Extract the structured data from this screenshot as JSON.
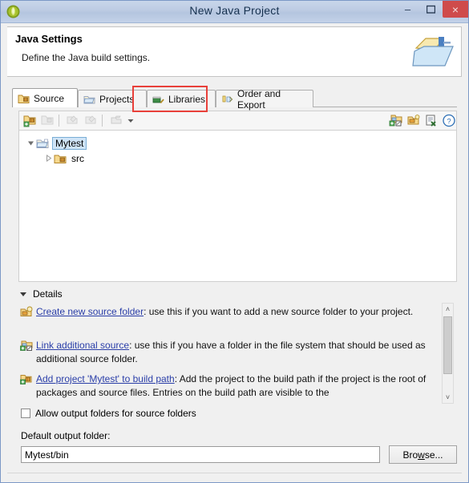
{
  "window": {
    "title": "New Java Project",
    "app_icon": "eclipse-icon",
    "controls": {
      "minimize": "–",
      "maximize": "❐",
      "close": "×"
    }
  },
  "header": {
    "title": "Java Settings",
    "subtitle": "Define the Java build settings.",
    "banner_icon": "java-project-wizard-icon"
  },
  "tabs": [
    {
      "label": "Source",
      "icon": "source-folder-icon",
      "active": true,
      "highlighted": false
    },
    {
      "label": "Projects",
      "icon": "projects-icon",
      "active": false,
      "highlighted": false
    },
    {
      "label": "Libraries",
      "icon": "libraries-icon",
      "active": false,
      "highlighted": true
    },
    {
      "label": "Order and Export",
      "icon": "order-export-icon",
      "active": false,
      "highlighted": false
    }
  ],
  "highlight": {
    "color": "#e8403a",
    "target": "Libraries"
  },
  "toolbar": {
    "left_items": [
      {
        "name": "add-folder-icon",
        "enabled": true
      },
      {
        "name": "add-source-folder-icon",
        "enabled": false
      },
      {
        "name": "edit-filter-icon",
        "enabled": false
      },
      {
        "name": "edit-exclusion-icon",
        "enabled": false
      },
      {
        "name": "configure-icon",
        "enabled": false
      },
      {
        "name": "chevron-down-icon",
        "enabled": true
      }
    ],
    "right_items": [
      {
        "name": "link-source-icon",
        "enabled": true
      },
      {
        "name": "create-new-folder-icon",
        "enabled": true
      },
      {
        "name": "remove-entry-icon",
        "enabled": true
      },
      {
        "name": "help-icon",
        "enabled": true
      }
    ]
  },
  "tree": {
    "nodes": [
      {
        "label": "Mytest",
        "icon": "project-folder-icon",
        "expanded": true,
        "selected": true
      },
      {
        "label": "src",
        "icon": "source-folder-icon",
        "expanded": false,
        "selected": false
      }
    ]
  },
  "details": {
    "section_label": "Details",
    "expanded": true,
    "items": [
      {
        "icon": "create-new-source-folder-icon",
        "link": "Create new source folder",
        "text": ": use this if you want to add a new source folder to your project."
      },
      {
        "icon": "link-additional-source-icon",
        "link": "Link additional source",
        "text": ": use this if you have a folder in the file system that should be used as additional source folder."
      },
      {
        "icon": "add-project-to-build-path-icon",
        "link": "Add project 'Mytest' to build path",
        "text": ": Add the project to the build path if the project is the root of packages and source files. Entries on the build path are visible to the"
      }
    ],
    "scrollbar": {
      "up": "˄",
      "down": "˅"
    }
  },
  "allow_output": {
    "label": "Allow output folders for source folders",
    "checked": false
  },
  "output_folder": {
    "label": "Default output folder:",
    "value": "Mytest/bin",
    "placeholder": "Mytest/bin",
    "browse_label": "Browse..."
  }
}
